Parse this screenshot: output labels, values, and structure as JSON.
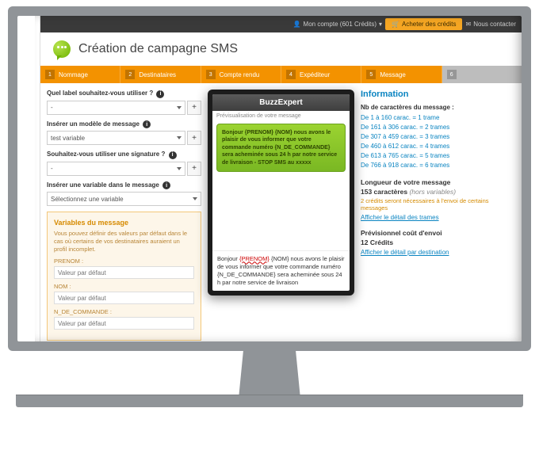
{
  "topbar": {
    "account_label": "Mon compte (601 Crédits)",
    "buy_label": "Acheter des crédits",
    "contact_label": "Nous contacter"
  },
  "title": "Création de campagne SMS",
  "steps": {
    "s1": {
      "num": "1",
      "label": "Nommage"
    },
    "s2": {
      "num": "2",
      "label": "Destinataires"
    },
    "s3": {
      "num": "3",
      "label": "Compte rendu"
    },
    "s4": {
      "num": "4",
      "label": "Expéditeur"
    },
    "s5": {
      "num": "5",
      "label": "Message"
    },
    "s6": {
      "num": "6",
      "label": ""
    }
  },
  "form": {
    "label_q": "Quel label souhaitez-vous utiliser ?",
    "label_sel": "-",
    "model_q": "Insérer un modèle de message",
    "model_sel": "test variable",
    "sig_q": "Souhaitez-vous utiliser une signature ?",
    "sig_sel": "-",
    "var_q": "Insérer une variable dans le message",
    "var_sel": "Sélectionnez une variable",
    "plus": "+",
    "info_glyph": "i"
  },
  "varbox": {
    "title": "Variables du message",
    "desc": "Vous pouvez définir des valeurs par défaut dans le cas où certains de vos destinataires auraient un profil incomplet.",
    "v1_label": "PRENOM :",
    "v1_ph": "Valeur par défaut",
    "v2_label": "NOM :",
    "v2_ph": "Valeur par défaut",
    "v3_label": "N_DE_COMMANDE :",
    "v3_ph": "Valeur par défaut"
  },
  "phone": {
    "brand": "BuzzExpert",
    "preview_label": "Prévisualisation de votre message",
    "bubble": "Bonjour {PRENOM} {NOM} nous avons le plaisir de vous informer que votre commande numéro {N_DE_COMMANDE} sera acheminée sous 24 h par notre service de livraison\n- STOP SMS au xxxxx",
    "raw_pre": "Bonjour ",
    "raw_err": "{PRENOM}",
    "raw_post": " {NOM} nous avons le plaisir de vous informer que votre commande numéro {N_DE_COMMANDE} sera acheminée sous 24 h par notre service de livraison"
  },
  "info": {
    "title": "Information",
    "chars_title": "Nb de caractères du message :",
    "r1": "De 1 à 160 carac. = 1 trame",
    "r2": "De 161 à 306 carac. = 2 trames",
    "r3": "De 307 à 459 carac. = 3 trames",
    "r4": "De 460 à 612 carac. = 4 trames",
    "r5": "De 613 à 765 carac. = 5 trames",
    "r6": "De 766 à 918 carac. = 6 trames",
    "len_title": "Longueur de votre message",
    "len_val": "153 caractères",
    "len_note": "(hors variables)",
    "len_warn": "2 crédits seront nécessaires à l'envoi de certains messages",
    "link_trames": "Afficher le détail des trames",
    "cost_title": "Prévisionnel coût d'envoi",
    "cost_val": "12 Crédits",
    "link_dest": "Afficher le détail par destination"
  }
}
